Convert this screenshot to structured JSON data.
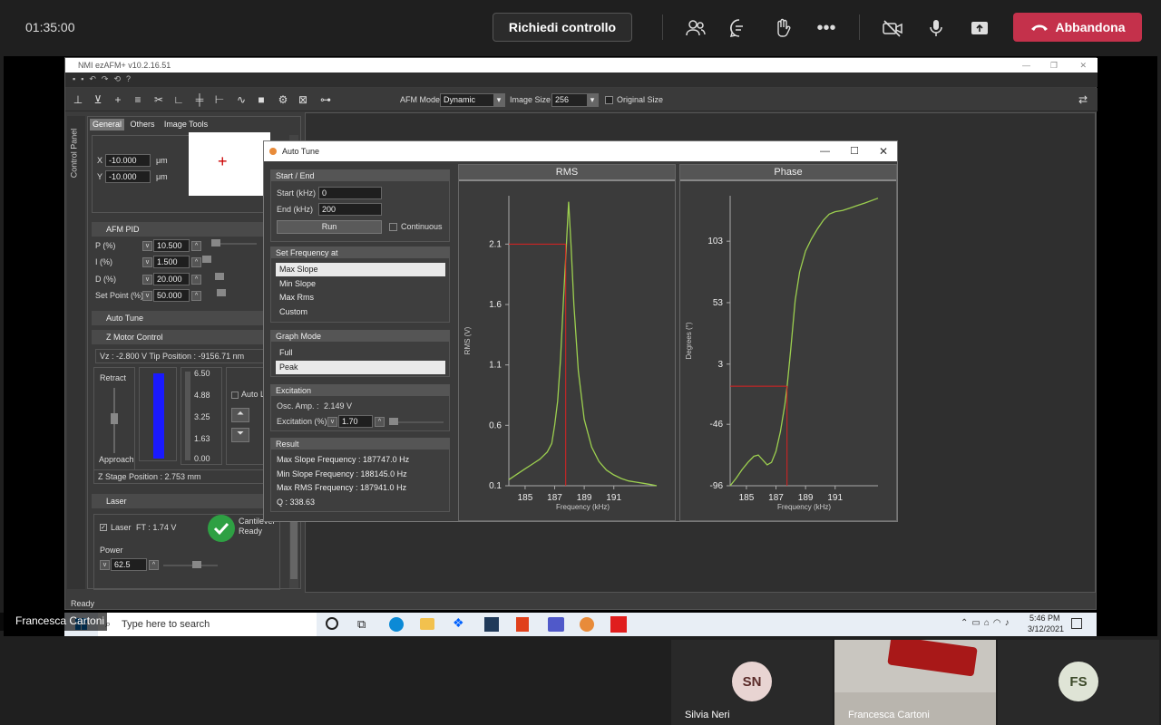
{
  "meeting": {
    "timer": "01:35:00",
    "request_control": "Richiedi controllo",
    "leave": "Abbandona",
    "presenter_label": "Francesca Cartoni"
  },
  "app": {
    "title": "NMI ezAFM+ v10.2.16.51",
    "afm_mode_label": "AFM Mode",
    "afm_mode_value": "Dynamic",
    "image_size_label": "Image Size",
    "image_size_value": "256",
    "original_size_label": "Original Size",
    "status": "Ready"
  },
  "control_panel": {
    "side_label": "Control Panel",
    "tabs": [
      "General",
      "Others",
      "Image Tools"
    ],
    "x_label": "X",
    "x_value": "-10.000",
    "x_unit": "μm",
    "y_label": "Y",
    "y_value": "-10.000",
    "y_unit": "μm",
    "afm_pid": "AFM PID",
    "p_label": "P (%)",
    "p_value": "10.500",
    "i_label": "I (%)",
    "i_value": "1.500",
    "d_label": "D (%)",
    "d_value": "20.000",
    "sp_label": "Set Point (%)",
    "sp_value": "50.000",
    "auto_tune": "Auto Tune",
    "z_motor": "Z Motor Control",
    "vz": "Vz :   -2.800 V  Tip Position :  -9156.71 nm",
    "retract": "Retract",
    "approach": "Approach",
    "scale": [
      "6.50",
      "4.88",
      "3.25",
      "1.63",
      "0.00"
    ],
    "auto_l": "Auto L",
    "z_stage": "Z Stage Position : 2.753 mm",
    "laser": "Laser",
    "laser_check": "Laser",
    "ft": "FT : 1.74 V",
    "cantilever": "Cantilever",
    "ready": "Ready",
    "power": "Power",
    "power_value": "62.5"
  },
  "auto_tune": {
    "title": "Auto Tune",
    "start_end": "Start / End",
    "start_label": "Start (kHz)",
    "start_value": "0",
    "end_label": "End (kHz)",
    "end_value": "200",
    "run": "Run",
    "continuous": "Continuous",
    "set_freq": "Set Frequency at",
    "freq_options": [
      "Max Slope",
      "Min Slope",
      "Max Rms",
      "Custom"
    ],
    "graph_mode": "Graph Mode",
    "graph_options": [
      "Full",
      "Peak"
    ],
    "excitation": "Excitation",
    "osc_amp_label": "Osc. Amp. :",
    "osc_amp_value": "2.149  V",
    "exc_label": "Excitation (%)",
    "exc_value": "1.70",
    "result": "Result",
    "results": [
      "Max Slope Frequency : 187747.0 Hz",
      "Min Slope Frequency : 188145.0 Hz",
      "Max RMS Frequency : 187941.0 Hz",
      "Q : 338.63"
    ]
  },
  "charts": {
    "rms_title": "RMS",
    "rms_ylabel": "RMS (V)",
    "rms_yticks": [
      "2.1",
      "1.6",
      "1.1",
      "0.6",
      "0.1"
    ],
    "phase_title": "Phase",
    "phase_ylabel": "Degrees (°)",
    "phase_yticks": [
      "103",
      "53",
      "3",
      "-46",
      "-96"
    ],
    "xticks": [
      "185",
      "187",
      "189",
      "191"
    ],
    "xlabel": "Frequency (kHz)"
  },
  "chart_data": [
    {
      "type": "line",
      "title": "RMS",
      "xlabel": "Frequency (kHz)",
      "ylabel": "RMS (V)",
      "xlim": [
        183.9,
        193.9
      ],
      "ylim": [
        0.1,
        2.5
      ],
      "series": [
        {
          "x": [
            183.9,
            184.5,
            185,
            185.5,
            186,
            186.5,
            186.8,
            187,
            187.2,
            187.4,
            187.6,
            187.75,
            187.94,
            188.1,
            188.3,
            188.6,
            189,
            189.5,
            190,
            190.5,
            191,
            191.5,
            192,
            192.5,
            193,
            193.5,
            193.9
          ],
          "values": [
            0.15,
            0.2,
            0.24,
            0.28,
            0.32,
            0.38,
            0.45,
            0.6,
            0.8,
            1.15,
            1.65,
            2.0,
            2.45,
            2.1,
            1.6,
            1.05,
            0.65,
            0.42,
            0.3,
            0.23,
            0.19,
            0.16,
            0.14,
            0.13,
            0.12,
            0.11,
            0.1
          ]
        }
      ],
      "marker": {
        "x": 187.747,
        "y": 2.1
      }
    },
    {
      "type": "line",
      "title": "Phase",
      "xlabel": "Frequency (kHz)",
      "ylabel": "Degrees (°)",
      "xlim": [
        183.9,
        193.9
      ],
      "ylim": [
        -96,
        140
      ],
      "series": [
        {
          "x": [
            183.9,
            184.3,
            184.7,
            185.1,
            185.5,
            185.8,
            186.1,
            186.4,
            186.7,
            187.0,
            187.3,
            187.6,
            187.75,
            188.0,
            188.3,
            188.6,
            189.0,
            189.4,
            189.8,
            190.2,
            190.6,
            191.0,
            191.5,
            192.0,
            192.5,
            193.0,
            193.9
          ],
          "values": [
            -96,
            -90,
            -83,
            -77,
            -72,
            -71,
            -75,
            -79,
            -77,
            -68,
            -52,
            -30,
            -15,
            15,
            55,
            78,
            95,
            105,
            113,
            120,
            125,
            127,
            128,
            130,
            132,
            134,
            138
          ]
        }
      ],
      "marker": {
        "x": 187.747,
        "y": -15
      }
    }
  ],
  "taskbar": {
    "search_placeholder": "Type here to search",
    "time": "5:46 PM",
    "date": "3/12/2021"
  },
  "participants": [
    {
      "initials": "SN",
      "name": "Silvia Neri"
    },
    {
      "initials": "",
      "name": "Francesca Cartoni"
    },
    {
      "initials": "FS",
      "name": ""
    }
  ]
}
